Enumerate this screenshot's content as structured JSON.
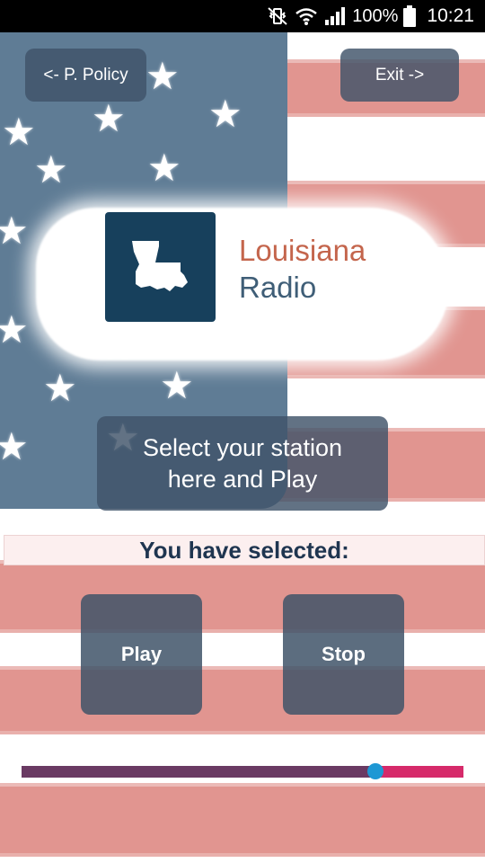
{
  "status_bar": {
    "battery": "100%",
    "time": "10:21"
  },
  "top_buttons": {
    "policy_label": "<- P. Policy",
    "exit_label": "Exit ->"
  },
  "logo": {
    "line1": "Louisiana",
    "line2": "Radio"
  },
  "station_selector": {
    "line1": "Select your station",
    "line2": "here and Play"
  },
  "selected_label": "You have selected:",
  "controls": {
    "play_label": "Play",
    "stop_label": "Stop"
  },
  "volume": {
    "value": 0.8
  },
  "colors": {
    "button_bg": "#405369",
    "logo_box": "#17405c",
    "logo_red": "#c4654c",
    "logo_blue": "#3f5e77",
    "slider_fill": "#6a3a63",
    "slider_track": "#d62a6a",
    "slider_thumb": "#1e98d4"
  },
  "icons": [
    "vibrate-icon",
    "wifi-icon",
    "signal-icon",
    "battery-icon"
  ]
}
